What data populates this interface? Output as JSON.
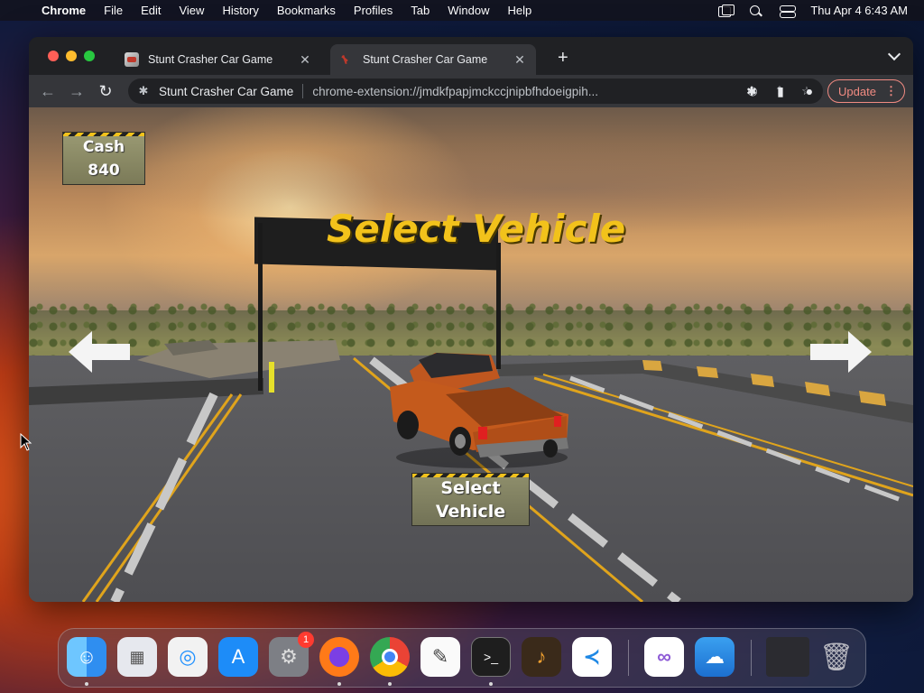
{
  "menubar": {
    "apple_icon": "apple-icon",
    "app_name": "Chrome",
    "menus": [
      "File",
      "Edit",
      "View",
      "History",
      "Bookmarks",
      "Profiles",
      "Tab",
      "Window",
      "Help"
    ],
    "clock": "Thu Apr 4  6:43 AM",
    "status_icons": [
      "screen-mirroring-icon",
      "search-icon",
      "control-center-icon"
    ]
  },
  "browser": {
    "tabs": [
      {
        "title": "Stunt Crasher Car Game",
        "active": false
      },
      {
        "title": "Stunt Crasher Car Game",
        "active": true
      }
    ],
    "new_tab_label": "+",
    "omnibox": {
      "site_name": "Stunt Crasher Car Game",
      "url": "chrome-extension://jmdkfpapjmckccjnipbfhdoeigpih..."
    },
    "update_label": "Update"
  },
  "game": {
    "title": "Select Vehicle",
    "cash_label": "Cash",
    "cash_value": "840",
    "select_button_line1": "Select",
    "select_button_line2": "Vehicle",
    "colors": {
      "title": "#f2c21b",
      "panel": "#8f8f6c",
      "hazard": "#f2c21b"
    }
  },
  "dock": {
    "apps": [
      {
        "name": "Finder",
        "icon": "finder-icon",
        "running": true
      },
      {
        "name": "Launchpad",
        "icon": "launchpad-icon",
        "running": false
      },
      {
        "name": "Safari",
        "icon": "safari-icon",
        "running": false
      },
      {
        "name": "App Store",
        "icon": "app-store-icon",
        "running": false
      },
      {
        "name": "System Settings",
        "icon": "system-settings-icon",
        "running": false,
        "badge": "1"
      },
      {
        "name": "Firefox",
        "icon": "firefox-icon",
        "running": true
      },
      {
        "name": "Chrome",
        "icon": "chrome-icon",
        "running": true
      },
      {
        "name": "TextEdit",
        "icon": "textedit-icon",
        "running": false
      },
      {
        "name": "Terminal",
        "icon": "terminal-icon",
        "running": true
      },
      {
        "name": "GarageBand",
        "icon": "garageband-icon",
        "running": false
      },
      {
        "name": "VS Code",
        "icon": "vscode-icon",
        "running": false
      },
      {
        "name": "Visual Studio",
        "icon": "visual-studio-icon",
        "running": false
      },
      {
        "name": "Weather",
        "icon": "weather-icon",
        "running": false
      },
      {
        "name": "Firefox Window",
        "icon": "minimized-window-icon",
        "running": false
      },
      {
        "name": "Trash",
        "icon": "trash-icon",
        "running": false
      }
    ]
  }
}
